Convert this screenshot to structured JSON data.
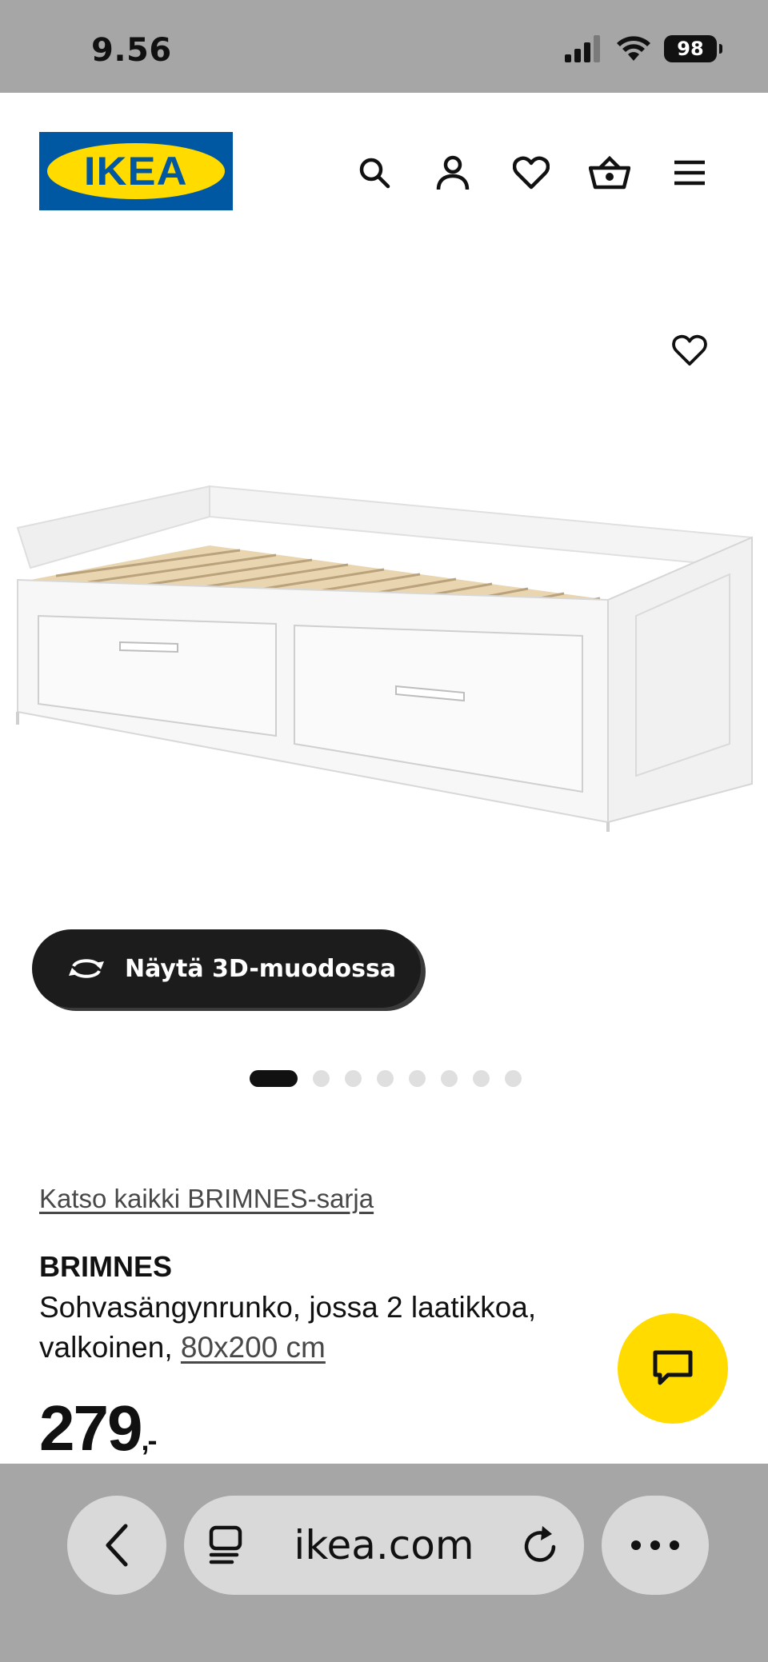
{
  "status_bar": {
    "time": "9.56",
    "battery": "98"
  },
  "header": {
    "logo_text": "IKEA",
    "icons": [
      "search-icon",
      "account-icon",
      "heart-icon",
      "basket-icon",
      "menu-icon"
    ]
  },
  "gallery": {
    "view_3d_label": "Näytä 3D-muodossa",
    "slide_count": 8,
    "active_slide": 1
  },
  "product": {
    "series_link": "Katso kaikki BRIMNES-sarja",
    "name": "BRIMNES",
    "description": "Sohvasängynrunko, jossa 2 laatikkoa, valkoinen,",
    "size": "80x200 cm",
    "price": "279",
    "price_suffix": ",-"
  },
  "browser": {
    "url": "ikea.com"
  },
  "colors": {
    "ikea_blue": "#0058a3",
    "ikea_yellow": "#ffdb00",
    "bar_gray": "#a6a6a6"
  }
}
